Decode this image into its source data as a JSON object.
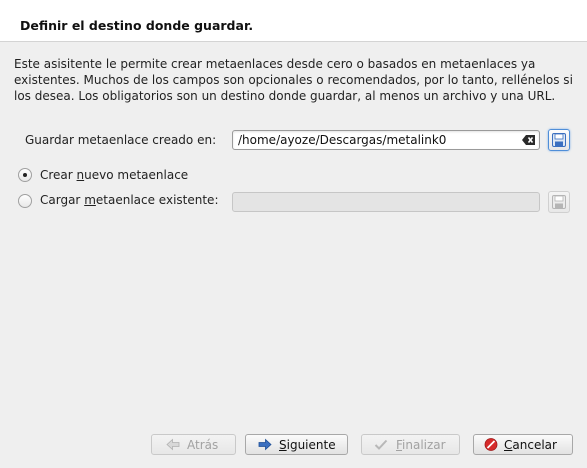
{
  "header": {
    "title": "Definir el destino donde guardar."
  },
  "intro": {
    "text": "Este asisitente le permite crear metaenlaces desde cero o basados en metaenlaces ya existentes. Muchos de los campos son opcionales o recomendados, por lo tanto, rellénelos si los desea. Los obligatorios son un destino donde guardar, al menos un archivo y una URL."
  },
  "save_path": {
    "label": "Guardar metaenlace creado en:",
    "value": "/home/ayoze/Descargas/metalink0",
    "clear_icon": "clear-text-icon",
    "browse_icon": "save-icon"
  },
  "options": {
    "create_new": {
      "label_pre": "Crear ",
      "label_mnemonic": "n",
      "label_post": "uevo metaenlace",
      "checked": true
    },
    "load_existing": {
      "label_pre": "Cargar ",
      "label_mnemonic": "m",
      "label_post": "etaenlace existente:",
      "checked": false,
      "enabled": false
    }
  },
  "buttons": {
    "back": {
      "label": "Atrás",
      "icon": "arrow-left-icon",
      "enabled": false
    },
    "next": {
      "label_mnemonic": "S",
      "label_post": "iguiente",
      "icon": "arrow-right-icon",
      "enabled": true
    },
    "finish": {
      "label_mnemonic": "F",
      "label_post": "inalizar",
      "icon": "checkmark-icon",
      "enabled": false
    },
    "cancel": {
      "label_mnemonic": "C",
      "label_post": "ancelar",
      "icon": "cancel-icon",
      "enabled": true
    }
  },
  "colors": {
    "accent_blue": "#3a6fc0",
    "cancel_red": "#d62a2a",
    "header_bg": "#ffffff",
    "body_bg": "#efefef"
  }
}
